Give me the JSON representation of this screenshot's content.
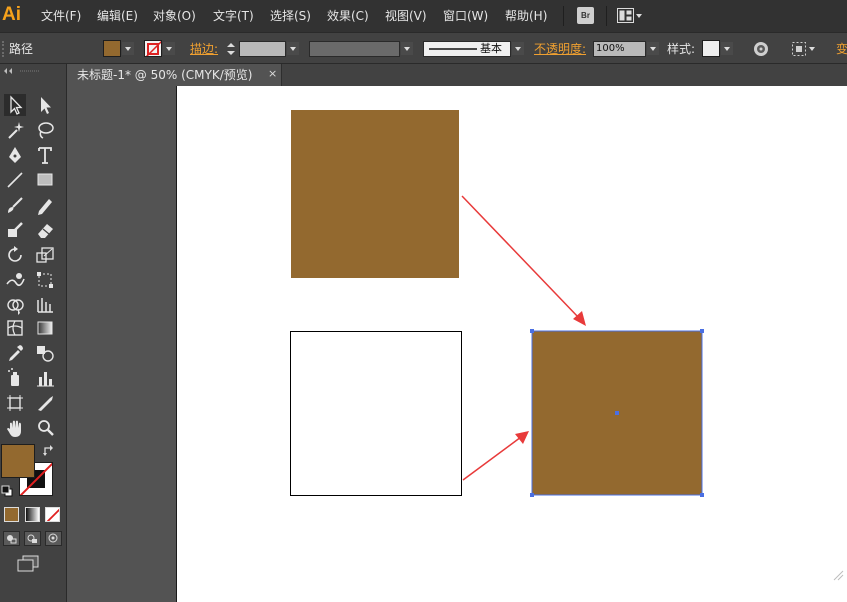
{
  "app": {
    "logo_text": "Ai",
    "brand_color": "#f7a21b"
  },
  "menu": {
    "items": [
      "文件(F)",
      "编辑(E)",
      "对象(O)",
      "文字(T)",
      "选择(S)",
      "效果(C)",
      "视图(V)",
      "窗口(W)",
      "帮助(H)"
    ],
    "bridge_label": "Br"
  },
  "control_bar": {
    "selection_type": "路径",
    "fill_color": "#93692f",
    "stroke_label": "描边:",
    "stroke_profile": "基本",
    "opacity_label": "不透明度:",
    "opacity_value": "100%",
    "style_label": "样式:",
    "overflow_label": "变"
  },
  "document": {
    "tab_title": "未标题-1* @ 50% (CMYK/预览)",
    "close_glyph": "×"
  },
  "tools": [
    "selection-tool",
    "direct-selection-tool",
    "magic-wand-tool",
    "lasso-tool",
    "pen-tool",
    "type-tool",
    "line-segment-tool",
    "rectangle-tool",
    "paintbrush-tool",
    "pencil-tool",
    "blob-brush-tool",
    "eraser-tool",
    "rotate-tool",
    "scale-tool",
    "warp-tool",
    "free-transform-tool",
    "shape-builder-tool",
    "graph-tool",
    "mesh-tool",
    "gradient-tool",
    "eyedropper-tool",
    "blend-tool",
    "symbol-sprayer-tool",
    "column-graph-tool",
    "artboard-tool",
    "slice-tool",
    "hand-tool",
    "zoom-tool"
  ],
  "tool_panel": {
    "fill_swatch_color": "#93692f",
    "stroke_swatch": "none",
    "modes": [
      "color-mode",
      "gradient-mode",
      "none-mode"
    ],
    "draw_modes": [
      "draw-normal",
      "draw-behind",
      "draw-inside"
    ]
  },
  "canvas": {
    "shape_color": "#93692f",
    "arrow_color": "#e83a3a",
    "selection_color": "#4a6fe3",
    "objects": [
      "filled-square-source",
      "empty-square-outline",
      "filled-square-selected"
    ]
  }
}
